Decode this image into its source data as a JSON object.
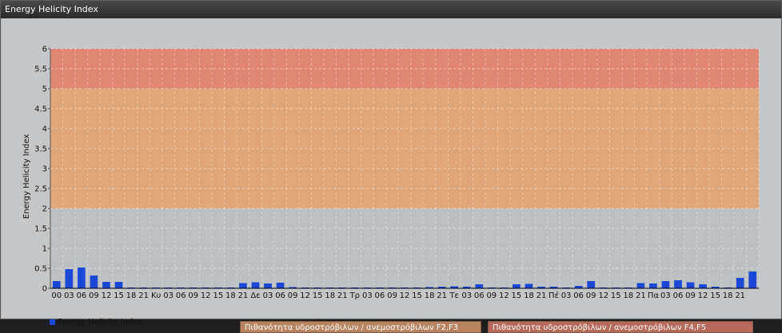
{
  "window": {
    "title": "Energy Helicity Index"
  },
  "colors": {
    "bar": "#1a47d6",
    "band_high": "#e3806a",
    "band_mid": "#e2a370",
    "band_low": "#bcbfc1",
    "band_label_mid": "#b8845f",
    "band_label_high": "#b86a5a"
  },
  "chart_data": {
    "type": "bar",
    "title": "",
    "ylabel": "Energy Helicity Index",
    "ylim": [
      0,
      6
    ],
    "yticks": [
      "0",
      "0.5",
      "1",
      "1.5",
      "2",
      "2.5",
      "3",
      "3.5",
      "4",
      "4.5",
      "5",
      "5.5",
      "6"
    ],
    "categories": [
      "00",
      "03",
      "06",
      "09",
      "12",
      "15",
      "18",
      "21",
      "Κυ",
      "03",
      "06",
      "09",
      "12",
      "15",
      "18",
      "21",
      "Δε",
      "03",
      "06",
      "09",
      "12",
      "15",
      "18",
      "21",
      "Τρ",
      "03",
      "06",
      "09",
      "12",
      "15",
      "18",
      "21",
      "Τε",
      "03",
      "06",
      "09",
      "12",
      "15",
      "18",
      "21",
      "Πέ",
      "03",
      "06",
      "09",
      "12",
      "15",
      "18",
      "21",
      "Πα",
      "03",
      "06",
      "09",
      "12",
      "15",
      "18",
      "21"
    ],
    "values": [
      0.18,
      0.48,
      0.52,
      0.32,
      0.16,
      0.16,
      0.02,
      0.02,
      0.02,
      0.02,
      0.02,
      0.02,
      0.02,
      0.02,
      0.02,
      0.13,
      0.15,
      0.12,
      0.14,
      0.03,
      0.02,
      0.02,
      0.02,
      0.02,
      0.02,
      0.02,
      0.02,
      0.02,
      0.02,
      0.02,
      0.03,
      0.04,
      0.05,
      0.04,
      0.1,
      0.02,
      0.02,
      0.1,
      0.11,
      0.04,
      0.04,
      0.02,
      0.06,
      0.18,
      0.02,
      0.02,
      0.02,
      0.13,
      0.12,
      0.18,
      0.2,
      0.15,
      0.1,
      0.04,
      0.02,
      0.26,
      0.42
    ],
    "legend": [
      "Energy Helicity Index"
    ],
    "legend_position": "bottom-left",
    "grid": true,
    "bands": [
      {
        "from": 0,
        "to": 2,
        "color": "band_low"
      },
      {
        "from": 2,
        "to": 5,
        "color": "band_mid",
        "label": "Πιθανότητα υδροστρόβιλων / ανεμοστρόβιλων F2,F3"
      },
      {
        "from": 5,
        "to": 6,
        "color": "band_high",
        "label": "Πιθανότητα υδροστρόβιλων / ανεμοστρόβιλων F4,F5"
      }
    ]
  }
}
